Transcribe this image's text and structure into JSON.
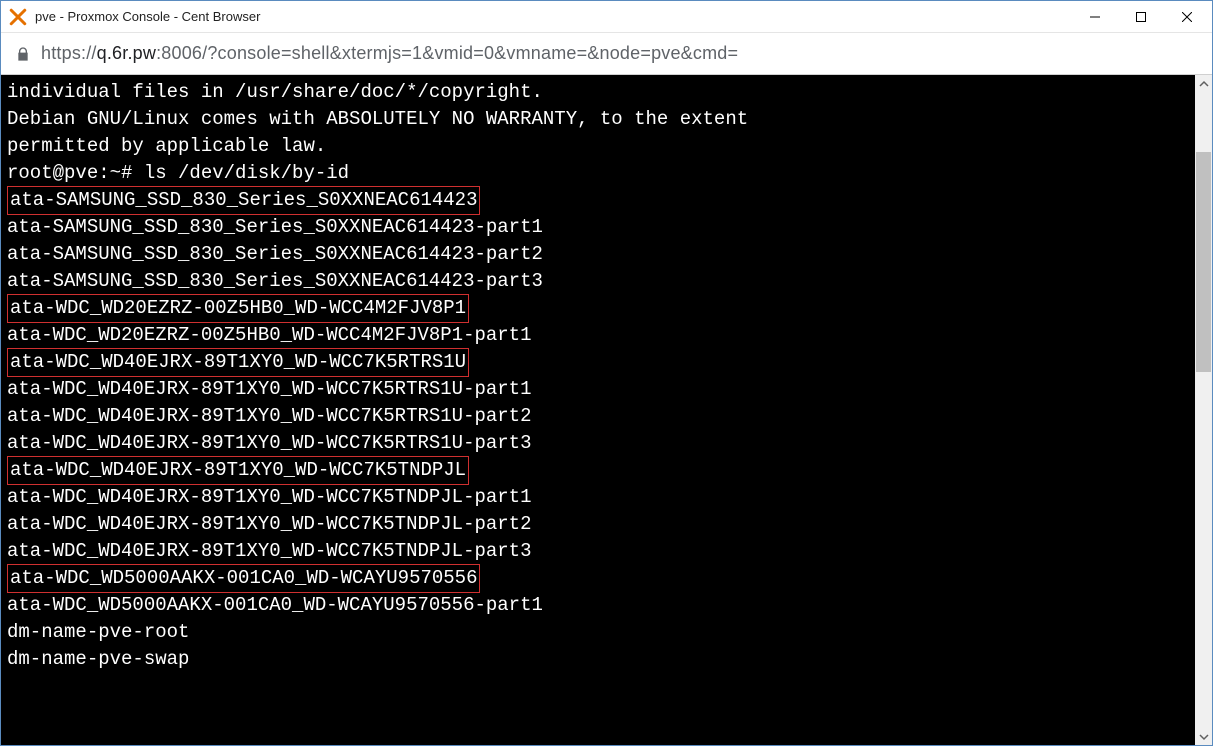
{
  "window": {
    "title": "pve - Proxmox Console - Cent Browser"
  },
  "address": {
    "scheme": "https://",
    "host": "q.6r.pw",
    "port_path": ":8006/?console=shell&xtermjs=1&vmid=0&vmname=&node=pve&cmd="
  },
  "terminal": {
    "lines": [
      {
        "text": "individual files in /usr/share/doc/*/copyright.",
        "hl": false
      },
      {
        "text": "",
        "hl": false
      },
      {
        "text": "Debian GNU/Linux comes with ABSOLUTELY NO WARRANTY, to the extent",
        "hl": false
      },
      {
        "text": "permitted by applicable law.",
        "hl": false
      },
      {
        "text": "root@pve:~# ls /dev/disk/by-id",
        "hl": false
      },
      {
        "text": "ata-SAMSUNG_SSD_830_Series_S0XXNEAC614423",
        "hl": true
      },
      {
        "text": "ata-SAMSUNG_SSD_830_Series_S0XXNEAC614423-part1",
        "hl": false
      },
      {
        "text": "ata-SAMSUNG_SSD_830_Series_S0XXNEAC614423-part2",
        "hl": false
      },
      {
        "text": "ata-SAMSUNG_SSD_830_Series_S0XXNEAC614423-part3",
        "hl": false
      },
      {
        "text": "ata-WDC_WD20EZRZ-00Z5HB0_WD-WCC4M2FJV8P1",
        "hl": true
      },
      {
        "text": "ata-WDC_WD20EZRZ-00Z5HB0_WD-WCC4M2FJV8P1-part1",
        "hl": false
      },
      {
        "text": "ata-WDC_WD40EJRX-89T1XY0_WD-WCC7K5RTRS1U",
        "hl": true
      },
      {
        "text": "ata-WDC_WD40EJRX-89T1XY0_WD-WCC7K5RTRS1U-part1",
        "hl": false
      },
      {
        "text": "ata-WDC_WD40EJRX-89T1XY0_WD-WCC7K5RTRS1U-part2",
        "hl": false
      },
      {
        "text": "ata-WDC_WD40EJRX-89T1XY0_WD-WCC7K5RTRS1U-part3",
        "hl": false
      },
      {
        "text": "ata-WDC_WD40EJRX-89T1XY0_WD-WCC7K5TNDPJL",
        "hl": true
      },
      {
        "text": "ata-WDC_WD40EJRX-89T1XY0_WD-WCC7K5TNDPJL-part1",
        "hl": false
      },
      {
        "text": "ata-WDC_WD40EJRX-89T1XY0_WD-WCC7K5TNDPJL-part2",
        "hl": false
      },
      {
        "text": "ata-WDC_WD40EJRX-89T1XY0_WD-WCC7K5TNDPJL-part3",
        "hl": false
      },
      {
        "text": "ata-WDC_WD5000AAKX-001CA0_WD-WCAYU9570556",
        "hl": true
      },
      {
        "text": "ata-WDC_WD5000AAKX-001CA0_WD-WCAYU9570556-part1",
        "hl": false
      },
      {
        "text": "dm-name-pve-root",
        "hl": false
      },
      {
        "text": "dm-name-pve-swap",
        "hl": false
      }
    ]
  }
}
